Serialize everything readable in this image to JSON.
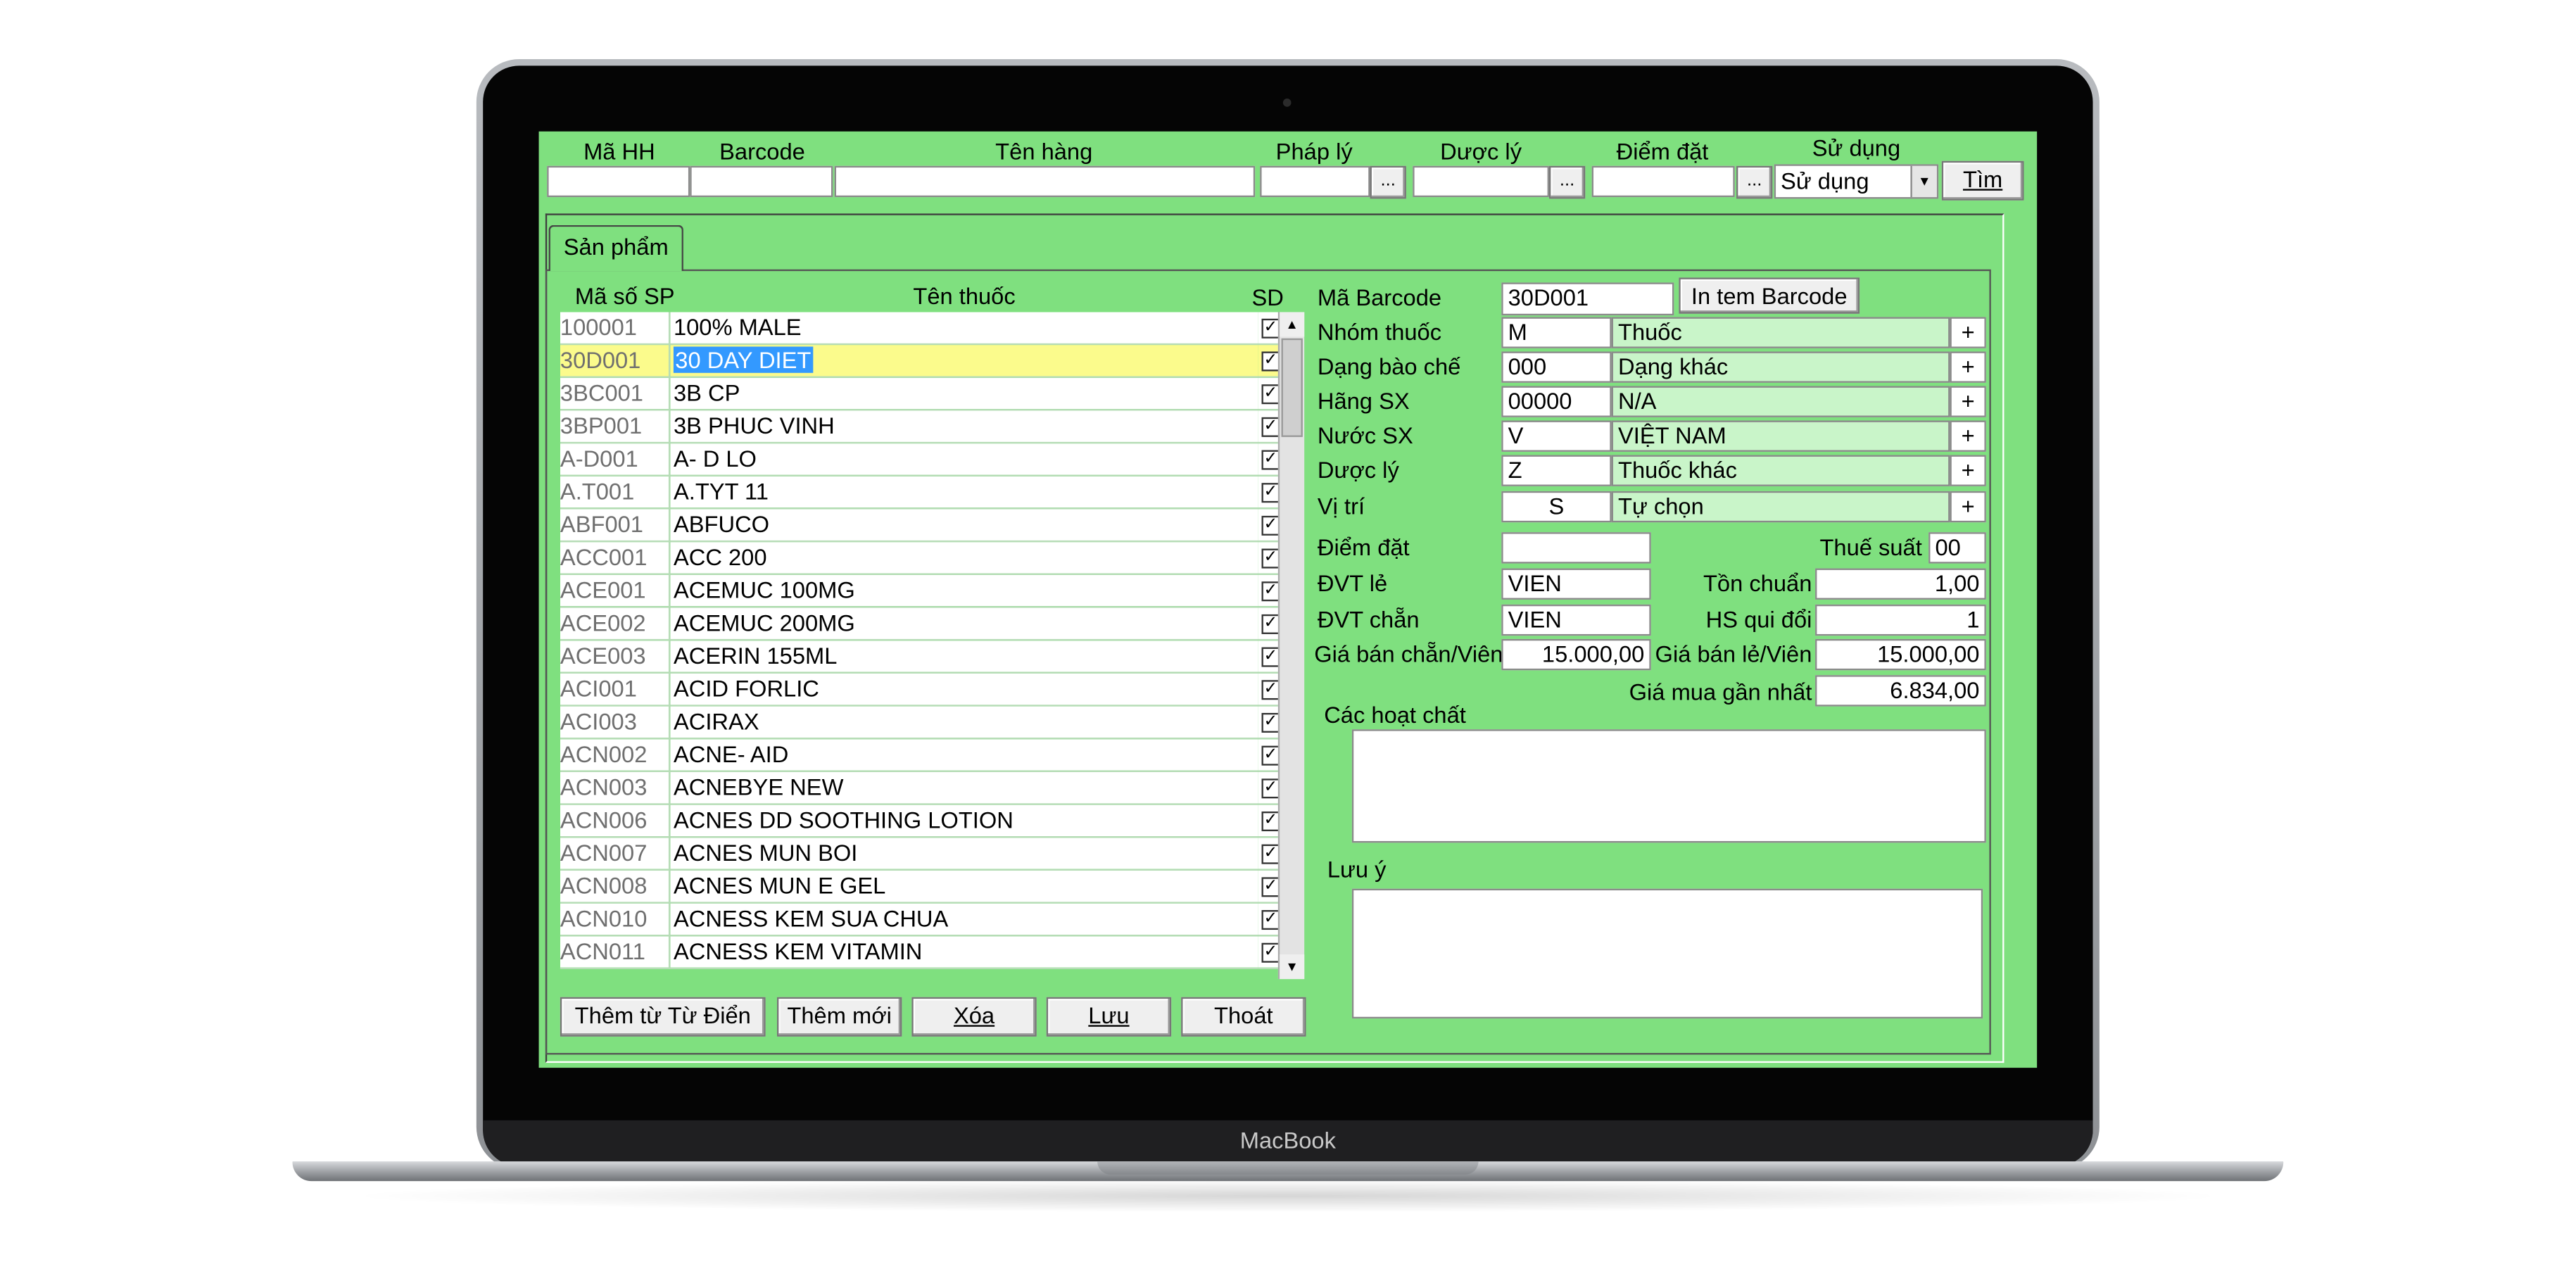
{
  "device": {
    "brand": "MacBook"
  },
  "search": {
    "labels": {
      "code": "Mã HH",
      "barcode": "Barcode",
      "name": "Tên hàng",
      "legal": "Pháp lý",
      "pharma": "Dược lý",
      "point": "Điểm đặt",
      "usage": "Sử dụng"
    },
    "browse": "...",
    "usage_value": "Sử dụng",
    "find_button": "Tìm"
  },
  "tab": {
    "label": "Sản phẩm"
  },
  "list": {
    "headers": {
      "code": "Mã số SP",
      "name": "Tên thuốc",
      "sd": "SD"
    },
    "check_mark": "✓",
    "rows": [
      {
        "code": "100001",
        "name": "100% MALE"
      },
      {
        "code": "30D001",
        "name": "30 DAY DIET"
      },
      {
        "code": "3BC001",
        "name": "3B CP"
      },
      {
        "code": "3BP001",
        "name": "3B PHUC VINH"
      },
      {
        "code": "A-D001",
        "name": "A- D LO"
      },
      {
        "code": "A.T001",
        "name": "A.TYT 11"
      },
      {
        "code": "ABF001",
        "name": "ABFUCO"
      },
      {
        "code": "ACC001",
        "name": "ACC 200"
      },
      {
        "code": "ACE001",
        "name": "ACEMUC 100MG"
      },
      {
        "code": "ACE002",
        "name": "ACEMUC 200MG"
      },
      {
        "code": "ACE003",
        "name": "ACERIN 155ML"
      },
      {
        "code": "ACI001",
        "name": "ACID FORLIC"
      },
      {
        "code": "ACI003",
        "name": "ACIRAX"
      },
      {
        "code": "ACN002",
        "name": "ACNE- AID"
      },
      {
        "code": "ACN003",
        "name": "ACNEBYE NEW"
      },
      {
        "code": "ACN006",
        "name": "ACNES DD SOOTHING LOTION"
      },
      {
        "code": "ACN007",
        "name": "ACNES MUN BOI"
      },
      {
        "code": "ACN008",
        "name": "ACNES MUN E GEL"
      },
      {
        "code": "ACN010",
        "name": "ACNESS KEM SUA CHUA"
      },
      {
        "code": "ACN011",
        "name": "ACNESS KEM VITAMIN"
      }
    ],
    "selected_index": 1
  },
  "buttons": {
    "add_dict": "Thêm từ Từ Điển",
    "add_new": "Thêm mới",
    "delete": "Xóa",
    "save": "Lưu",
    "exit": "Thoát"
  },
  "detail": {
    "barcode_label": "Mã Barcode",
    "barcode_value": "30D001",
    "print_button": "In tem Barcode",
    "plus": "+",
    "group": {
      "label": "Nhóm thuốc",
      "code": "M",
      "name": "Thuốc"
    },
    "form": {
      "label": "Dạng bào chế",
      "code": "000",
      "name": "Dạng khác"
    },
    "maker": {
      "label": "Hãng SX",
      "code": "00000",
      "name": "N/A"
    },
    "country": {
      "label": "Nước SX",
      "code": "V",
      "name": "VIỆT NAM"
    },
    "pharma": {
      "label": "Dược lý",
      "code": "Z",
      "name": "Thuốc khác"
    },
    "location": {
      "label": "Vị trí",
      "code": "S",
      "name": "Tự chọn"
    },
    "point_label": "Điểm đặt",
    "point_value": "",
    "tax_label": "Thuế suất",
    "tax_value": "00",
    "unit_retail_label": "ĐVT lẻ",
    "unit_retail_value": "VIEN",
    "stock_label": "Tồn chuẩn",
    "stock_value": "1,00",
    "unit_pack_label": "ĐVT chẵn",
    "unit_pack_value": "VIEN",
    "factor_label": "HS qui đổi",
    "factor_value": "1",
    "price_pack_label": "Giá bán chẵn/Viên",
    "price_pack_value": "15.000,00",
    "price_retail_label": "Giá bán lẻ/Viên",
    "price_retail_value": "15.000,00",
    "last_buy_label": "Giá mua gần nhất",
    "last_buy_value": "6.834,00",
    "ingredients_label": "Các hoạt chất",
    "note_label": "Lưu ý"
  }
}
